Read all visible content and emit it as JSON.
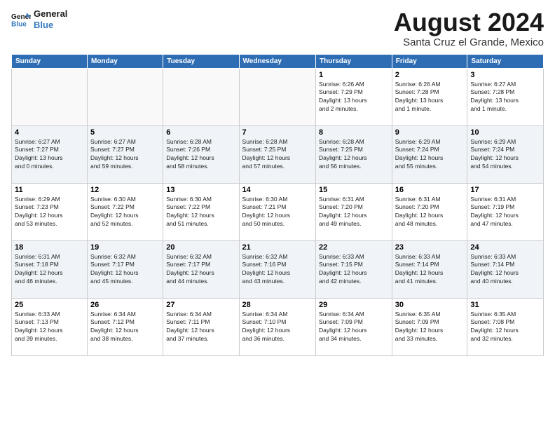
{
  "logo": {
    "line1": "General",
    "line2": "Blue"
  },
  "title": "August 2024",
  "subtitle": "Santa Cruz el Grande, Mexico",
  "days_of_week": [
    "Sunday",
    "Monday",
    "Tuesday",
    "Wednesday",
    "Thursday",
    "Friday",
    "Saturday"
  ],
  "weeks": [
    {
      "days": [
        {
          "num": "",
          "info": ""
        },
        {
          "num": "",
          "info": ""
        },
        {
          "num": "",
          "info": ""
        },
        {
          "num": "",
          "info": ""
        },
        {
          "num": "1",
          "info": "Sunrise: 6:26 AM\nSunset: 7:29 PM\nDaylight: 13 hours\nand 2 minutes."
        },
        {
          "num": "2",
          "info": "Sunrise: 6:26 AM\nSunset: 7:28 PM\nDaylight: 13 hours\nand 1 minute."
        },
        {
          "num": "3",
          "info": "Sunrise: 6:27 AM\nSunset: 7:28 PM\nDaylight: 13 hours\nand 1 minute."
        }
      ]
    },
    {
      "days": [
        {
          "num": "4",
          "info": "Sunrise: 6:27 AM\nSunset: 7:27 PM\nDaylight: 13 hours\nand 0 minutes."
        },
        {
          "num": "5",
          "info": "Sunrise: 6:27 AM\nSunset: 7:27 PM\nDaylight: 12 hours\nand 59 minutes."
        },
        {
          "num": "6",
          "info": "Sunrise: 6:28 AM\nSunset: 7:26 PM\nDaylight: 12 hours\nand 58 minutes."
        },
        {
          "num": "7",
          "info": "Sunrise: 6:28 AM\nSunset: 7:25 PM\nDaylight: 12 hours\nand 57 minutes."
        },
        {
          "num": "8",
          "info": "Sunrise: 6:28 AM\nSunset: 7:25 PM\nDaylight: 12 hours\nand 56 minutes."
        },
        {
          "num": "9",
          "info": "Sunrise: 6:29 AM\nSunset: 7:24 PM\nDaylight: 12 hours\nand 55 minutes."
        },
        {
          "num": "10",
          "info": "Sunrise: 6:29 AM\nSunset: 7:24 PM\nDaylight: 12 hours\nand 54 minutes."
        }
      ]
    },
    {
      "days": [
        {
          "num": "11",
          "info": "Sunrise: 6:29 AM\nSunset: 7:23 PM\nDaylight: 12 hours\nand 53 minutes."
        },
        {
          "num": "12",
          "info": "Sunrise: 6:30 AM\nSunset: 7:22 PM\nDaylight: 12 hours\nand 52 minutes."
        },
        {
          "num": "13",
          "info": "Sunrise: 6:30 AM\nSunset: 7:22 PM\nDaylight: 12 hours\nand 51 minutes."
        },
        {
          "num": "14",
          "info": "Sunrise: 6:30 AM\nSunset: 7:21 PM\nDaylight: 12 hours\nand 50 minutes."
        },
        {
          "num": "15",
          "info": "Sunrise: 6:31 AM\nSunset: 7:20 PM\nDaylight: 12 hours\nand 49 minutes."
        },
        {
          "num": "16",
          "info": "Sunrise: 6:31 AM\nSunset: 7:20 PM\nDaylight: 12 hours\nand 48 minutes."
        },
        {
          "num": "17",
          "info": "Sunrise: 6:31 AM\nSunset: 7:19 PM\nDaylight: 12 hours\nand 47 minutes."
        }
      ]
    },
    {
      "days": [
        {
          "num": "18",
          "info": "Sunrise: 6:31 AM\nSunset: 7:18 PM\nDaylight: 12 hours\nand 46 minutes."
        },
        {
          "num": "19",
          "info": "Sunrise: 6:32 AM\nSunset: 7:17 PM\nDaylight: 12 hours\nand 45 minutes."
        },
        {
          "num": "20",
          "info": "Sunrise: 6:32 AM\nSunset: 7:17 PM\nDaylight: 12 hours\nand 44 minutes."
        },
        {
          "num": "21",
          "info": "Sunrise: 6:32 AM\nSunset: 7:16 PM\nDaylight: 12 hours\nand 43 minutes."
        },
        {
          "num": "22",
          "info": "Sunrise: 6:33 AM\nSunset: 7:15 PM\nDaylight: 12 hours\nand 42 minutes."
        },
        {
          "num": "23",
          "info": "Sunrise: 6:33 AM\nSunset: 7:14 PM\nDaylight: 12 hours\nand 41 minutes."
        },
        {
          "num": "24",
          "info": "Sunrise: 6:33 AM\nSunset: 7:14 PM\nDaylight: 12 hours\nand 40 minutes."
        }
      ]
    },
    {
      "days": [
        {
          "num": "25",
          "info": "Sunrise: 6:33 AM\nSunset: 7:13 PM\nDaylight: 12 hours\nand 39 minutes."
        },
        {
          "num": "26",
          "info": "Sunrise: 6:34 AM\nSunset: 7:12 PM\nDaylight: 12 hours\nand 38 minutes."
        },
        {
          "num": "27",
          "info": "Sunrise: 6:34 AM\nSunset: 7:11 PM\nDaylight: 12 hours\nand 37 minutes."
        },
        {
          "num": "28",
          "info": "Sunrise: 6:34 AM\nSunset: 7:10 PM\nDaylight: 12 hours\nand 36 minutes."
        },
        {
          "num": "29",
          "info": "Sunrise: 6:34 AM\nSunset: 7:09 PM\nDaylight: 12 hours\nand 34 minutes."
        },
        {
          "num": "30",
          "info": "Sunrise: 6:35 AM\nSunset: 7:09 PM\nDaylight: 12 hours\nand 33 minutes."
        },
        {
          "num": "31",
          "info": "Sunrise: 6:35 AM\nSunset: 7:08 PM\nDaylight: 12 hours\nand 32 minutes."
        }
      ]
    }
  ]
}
